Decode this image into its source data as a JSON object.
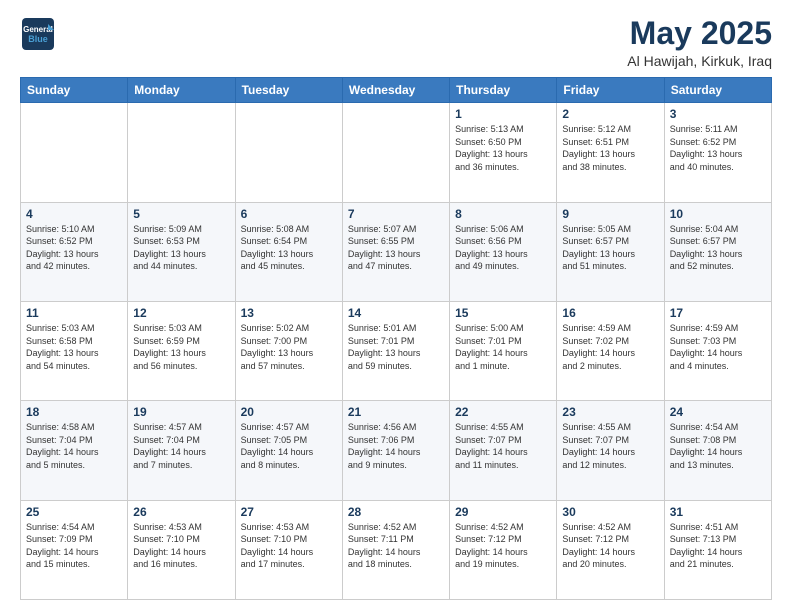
{
  "logo": {
    "line1": "General",
    "line2": "Blue"
  },
  "header": {
    "month": "May 2025",
    "location": "Al Hawijah, Kirkuk, Iraq"
  },
  "weekdays": [
    "Sunday",
    "Monday",
    "Tuesday",
    "Wednesday",
    "Thursday",
    "Friday",
    "Saturday"
  ],
  "weeks": [
    [
      {
        "day": "",
        "info": ""
      },
      {
        "day": "",
        "info": ""
      },
      {
        "day": "",
        "info": ""
      },
      {
        "day": "",
        "info": ""
      },
      {
        "day": "1",
        "info": "Sunrise: 5:13 AM\nSunset: 6:50 PM\nDaylight: 13 hours\nand 36 minutes."
      },
      {
        "day": "2",
        "info": "Sunrise: 5:12 AM\nSunset: 6:51 PM\nDaylight: 13 hours\nand 38 minutes."
      },
      {
        "day": "3",
        "info": "Sunrise: 5:11 AM\nSunset: 6:52 PM\nDaylight: 13 hours\nand 40 minutes."
      }
    ],
    [
      {
        "day": "4",
        "info": "Sunrise: 5:10 AM\nSunset: 6:52 PM\nDaylight: 13 hours\nand 42 minutes."
      },
      {
        "day": "5",
        "info": "Sunrise: 5:09 AM\nSunset: 6:53 PM\nDaylight: 13 hours\nand 44 minutes."
      },
      {
        "day": "6",
        "info": "Sunrise: 5:08 AM\nSunset: 6:54 PM\nDaylight: 13 hours\nand 45 minutes."
      },
      {
        "day": "7",
        "info": "Sunrise: 5:07 AM\nSunset: 6:55 PM\nDaylight: 13 hours\nand 47 minutes."
      },
      {
        "day": "8",
        "info": "Sunrise: 5:06 AM\nSunset: 6:56 PM\nDaylight: 13 hours\nand 49 minutes."
      },
      {
        "day": "9",
        "info": "Sunrise: 5:05 AM\nSunset: 6:57 PM\nDaylight: 13 hours\nand 51 minutes."
      },
      {
        "day": "10",
        "info": "Sunrise: 5:04 AM\nSunset: 6:57 PM\nDaylight: 13 hours\nand 52 minutes."
      }
    ],
    [
      {
        "day": "11",
        "info": "Sunrise: 5:03 AM\nSunset: 6:58 PM\nDaylight: 13 hours\nand 54 minutes."
      },
      {
        "day": "12",
        "info": "Sunrise: 5:03 AM\nSunset: 6:59 PM\nDaylight: 13 hours\nand 56 minutes."
      },
      {
        "day": "13",
        "info": "Sunrise: 5:02 AM\nSunset: 7:00 PM\nDaylight: 13 hours\nand 57 minutes."
      },
      {
        "day": "14",
        "info": "Sunrise: 5:01 AM\nSunset: 7:01 PM\nDaylight: 13 hours\nand 59 minutes."
      },
      {
        "day": "15",
        "info": "Sunrise: 5:00 AM\nSunset: 7:01 PM\nDaylight: 14 hours\nand 1 minute."
      },
      {
        "day": "16",
        "info": "Sunrise: 4:59 AM\nSunset: 7:02 PM\nDaylight: 14 hours\nand 2 minutes."
      },
      {
        "day": "17",
        "info": "Sunrise: 4:59 AM\nSunset: 7:03 PM\nDaylight: 14 hours\nand 4 minutes."
      }
    ],
    [
      {
        "day": "18",
        "info": "Sunrise: 4:58 AM\nSunset: 7:04 PM\nDaylight: 14 hours\nand 5 minutes."
      },
      {
        "day": "19",
        "info": "Sunrise: 4:57 AM\nSunset: 7:04 PM\nDaylight: 14 hours\nand 7 minutes."
      },
      {
        "day": "20",
        "info": "Sunrise: 4:57 AM\nSunset: 7:05 PM\nDaylight: 14 hours\nand 8 minutes."
      },
      {
        "day": "21",
        "info": "Sunrise: 4:56 AM\nSunset: 7:06 PM\nDaylight: 14 hours\nand 9 minutes."
      },
      {
        "day": "22",
        "info": "Sunrise: 4:55 AM\nSunset: 7:07 PM\nDaylight: 14 hours\nand 11 minutes."
      },
      {
        "day": "23",
        "info": "Sunrise: 4:55 AM\nSunset: 7:07 PM\nDaylight: 14 hours\nand 12 minutes."
      },
      {
        "day": "24",
        "info": "Sunrise: 4:54 AM\nSunset: 7:08 PM\nDaylight: 14 hours\nand 13 minutes."
      }
    ],
    [
      {
        "day": "25",
        "info": "Sunrise: 4:54 AM\nSunset: 7:09 PM\nDaylight: 14 hours\nand 15 minutes."
      },
      {
        "day": "26",
        "info": "Sunrise: 4:53 AM\nSunset: 7:10 PM\nDaylight: 14 hours\nand 16 minutes."
      },
      {
        "day": "27",
        "info": "Sunrise: 4:53 AM\nSunset: 7:10 PM\nDaylight: 14 hours\nand 17 minutes."
      },
      {
        "day": "28",
        "info": "Sunrise: 4:52 AM\nSunset: 7:11 PM\nDaylight: 14 hours\nand 18 minutes."
      },
      {
        "day": "29",
        "info": "Sunrise: 4:52 AM\nSunset: 7:12 PM\nDaylight: 14 hours\nand 19 minutes."
      },
      {
        "day": "30",
        "info": "Sunrise: 4:52 AM\nSunset: 7:12 PM\nDaylight: 14 hours\nand 20 minutes."
      },
      {
        "day": "31",
        "info": "Sunrise: 4:51 AM\nSunset: 7:13 PM\nDaylight: 14 hours\nand 21 minutes."
      }
    ]
  ]
}
